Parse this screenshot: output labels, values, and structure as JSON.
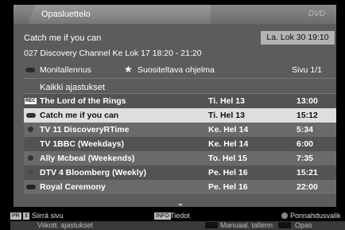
{
  "header": {
    "title": "Opasluettelo",
    "logo": "DVD"
  },
  "program": {
    "title": "Catch me if you can",
    "datetime": "La. Lok 30   19:10",
    "info": "027 Discovery Channel Ke Lok 17    18:20 - 21:20"
  },
  "legend": {
    "monitor_label": "Monitallennus",
    "recommended_label": "Suositeltava ohjelma",
    "page_indicator": "Sivu 1/1"
  },
  "list": {
    "section_title": "Kaikki ajastukset",
    "rows": [
      {
        "icon": "rec",
        "name": "The Lord of the Rings",
        "day": "Ti. Hel 13",
        "time": "13:00"
      },
      {
        "icon": "bar",
        "name": "Catch me if you can",
        "day": "Ti. Hel 13",
        "time": "15:12"
      },
      {
        "icon": "circle-info",
        "name": "TV  11 DiscoveryRTime",
        "day": "Ke. Hel 14",
        "time": "5:34"
      },
      {
        "icon": "exclaim",
        "name": "TV  1BBC (Weekdays)",
        "day": "Ke. Hel 14",
        "time": "6:00"
      },
      {
        "icon": "circle",
        "name": "Ally Mcbeal (Weekends)",
        "day": "To. Hel 15",
        "time": "7:35"
      },
      {
        "icon": "circle-dim",
        "name": "DTV 4 Bloomberg (Weekly)",
        "day": "Pe. Hel 16",
        "time": "15:21"
      },
      {
        "icon": "bar",
        "name": "Royal Ceremony",
        "day": "Pe. Hel 16",
        "time": "22:00"
      }
    ]
  },
  "footer": {
    "pr_key": "PR",
    "pr_label": "Siirrä sivu",
    "info_key": "INFO",
    "info_label": "Tiedot",
    "popup_label": "Ponnahdusvalik",
    "weekly_label": "Viikott. ajastukset",
    "manual_label": "Manuaal. tallenn",
    "guide_label": "Opas"
  }
}
